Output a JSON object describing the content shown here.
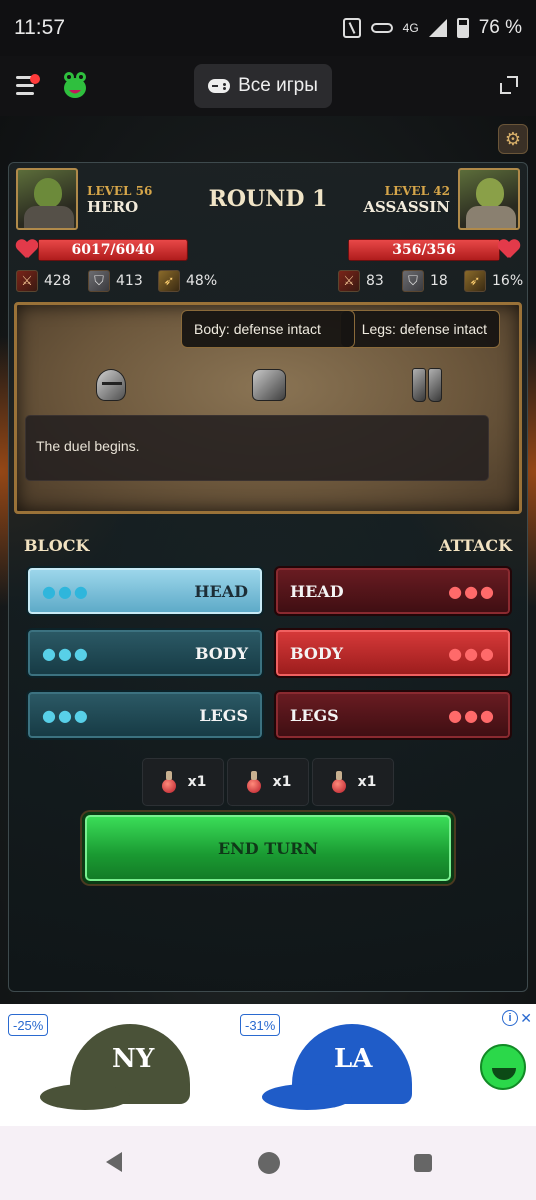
{
  "status_bar": {
    "time": "11:57",
    "network": "4G",
    "battery": "76 %"
  },
  "app_header": {
    "all_games_label": "Все игры"
  },
  "game": {
    "round_label": "ROUND 1",
    "player": {
      "level": "LEVEL 56",
      "name": "HERO",
      "hp": "6017/6040",
      "hp_fraction": 0.996,
      "attack": "428",
      "defense": "413",
      "crit": "48%"
    },
    "enemy": {
      "level": "LEVEL 42",
      "name": "ASSASSIN",
      "hp": "356/356",
      "hp_fraction": 1.0,
      "attack": "83",
      "defense": "18",
      "crit": "16%"
    },
    "tooltips": {
      "body": "Body: defense intact",
      "legs": "Legs: defense intact"
    },
    "log_text": "The duel begins.",
    "block_label": "BLOCK",
    "attack_label": "ATTACK",
    "block_options": [
      {
        "label": "HEAD",
        "dots": "●●●"
      },
      {
        "label": "BODY",
        "dots": "●●●"
      },
      {
        "label": "LEGS",
        "dots": "●●●"
      }
    ],
    "attack_options": [
      {
        "label": "HEAD",
        "dots": "●●●"
      },
      {
        "label": "BODY",
        "dots": "●●●"
      },
      {
        "label": "LEGS",
        "dots": "●●●"
      }
    ],
    "potions": [
      {
        "count": "x1"
      },
      {
        "count": "x1"
      },
      {
        "count": "x1"
      }
    ],
    "end_turn_label": "END TURN"
  },
  "ad": {
    "items": [
      {
        "discount": "-25%",
        "logo": "NY",
        "color": "#4a5238"
      },
      {
        "discount": "-31%",
        "logo": "LA",
        "color": "#1f5cc8"
      }
    ],
    "info_icon": "i",
    "close_icon": "✕"
  }
}
